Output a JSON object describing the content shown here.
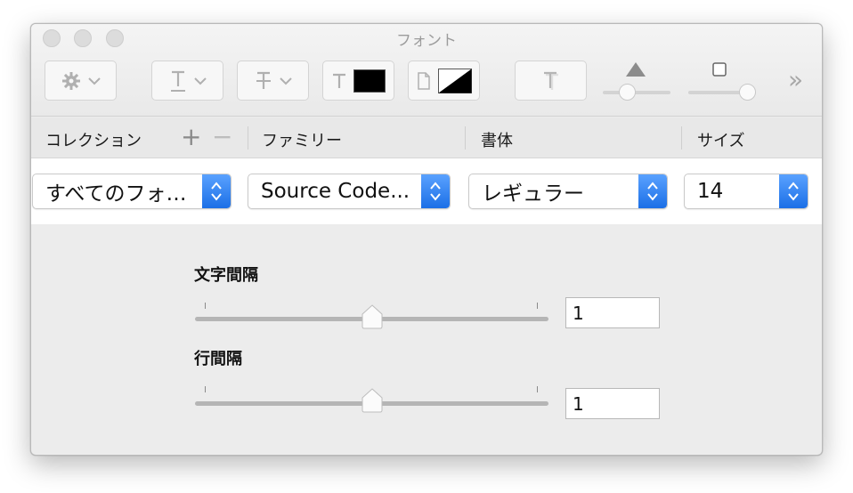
{
  "window": {
    "title": "フォント"
  },
  "toolbar": {
    "action_icon": "gear-icon",
    "underline_icon": "underline-icon",
    "strikethrough_icon": "strikethrough-icon",
    "text_color_icon": "text-color-icon",
    "text_color": "#000000",
    "doc_color_icon": "document-color-icon",
    "shadow_icon": "text-shadow-icon",
    "more_label": "»"
  },
  "columns": {
    "collection": "コレクション",
    "add": "+",
    "remove": "−",
    "family": "ファミリー",
    "typeface": "書体",
    "size": "サイズ"
  },
  "popups": {
    "collection": "すべてのフォ…",
    "family": "Source Code...",
    "typeface": "レギュラー",
    "size": "14"
  },
  "spacing": {
    "character_label": "文字間隔",
    "character_value": "1",
    "line_label": "行間隔",
    "line_value": "1"
  },
  "colors": {
    "accent": "#1b6fe6",
    "window_bg": "#ececec"
  }
}
